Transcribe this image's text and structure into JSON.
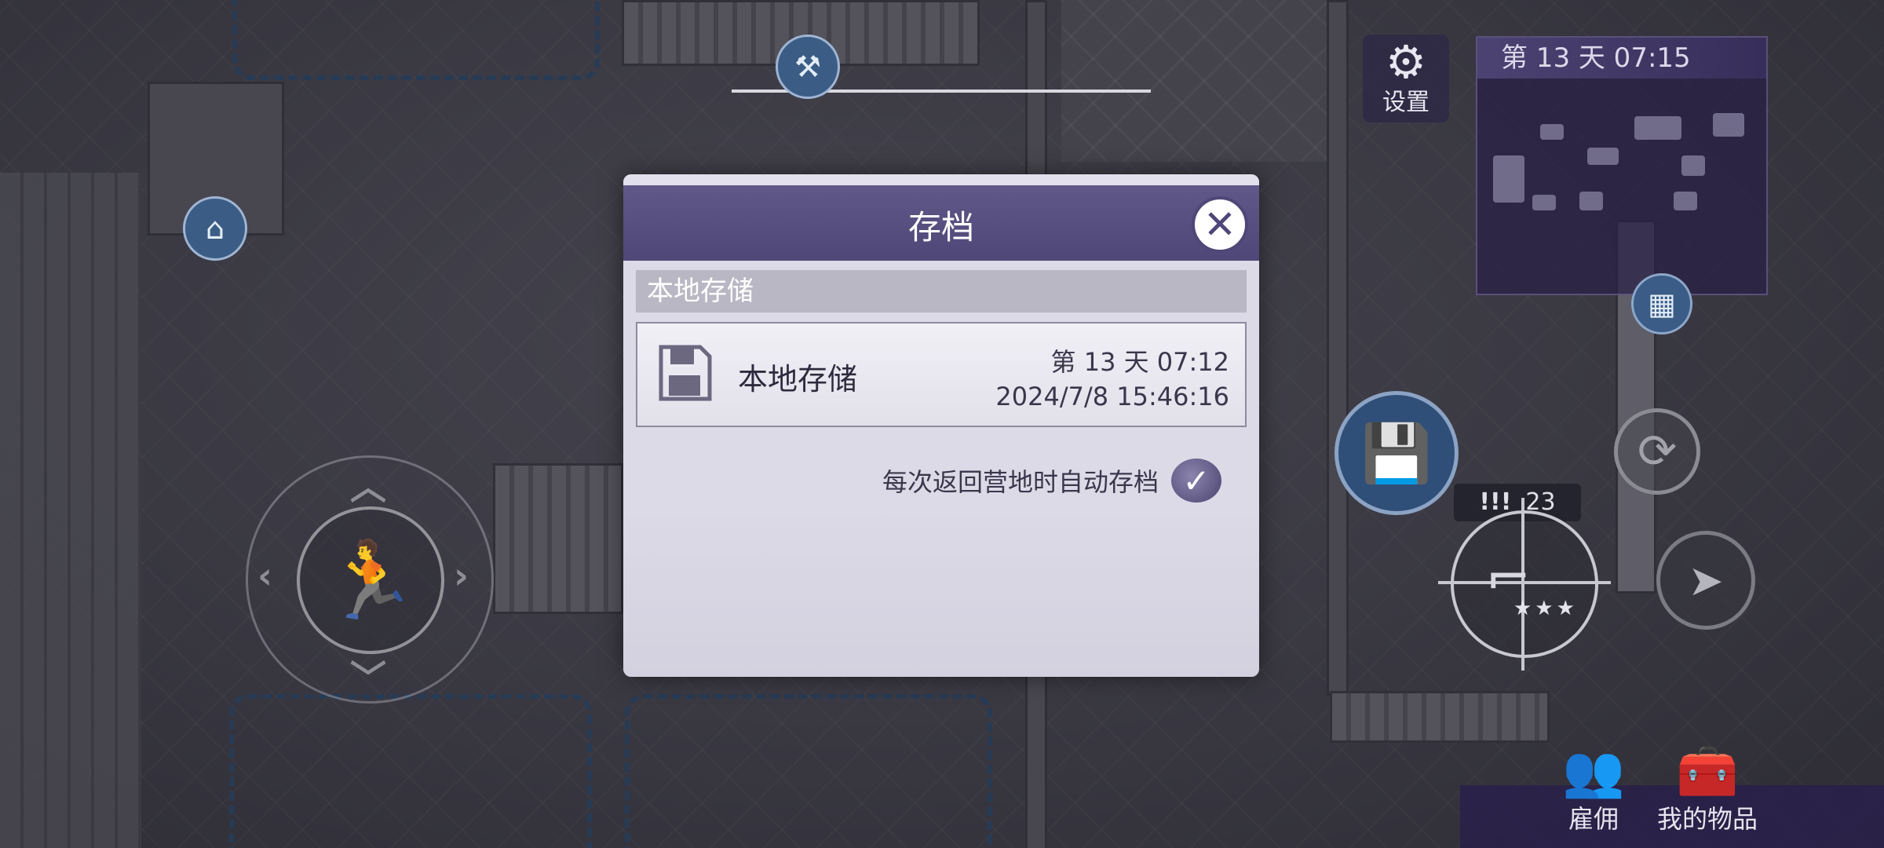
{
  "hud": {
    "settings_label": "设置",
    "day_time": "第 13 天  07:15",
    "ammo_warning": "!!!",
    "ammo_count": "23",
    "weapon_rating": "★★★",
    "bottom": {
      "hire_label": "雇佣",
      "items_label": "我的物品"
    },
    "icons": {
      "settings": "gear-icon",
      "run": "running-man-icon",
      "save": "save-upload-icon",
      "sync": "sync-icon",
      "dash": "dash-icon",
      "map": "map-icon",
      "dog": "dog-house-icon",
      "fork": "pitchfork-icon",
      "weapon": "shotgun-icon",
      "hire": "people-icon",
      "items": "chest-icon"
    }
  },
  "dialog": {
    "title": "存档",
    "close_icon": "close-icon",
    "section_label": "本地存储",
    "slot": {
      "name": "本地存储",
      "day_time": "第 13 天  07:12",
      "datetime": "2024/7/8 15:46:16",
      "icon": "floppy-disk-icon"
    },
    "auto_save_label": "每次返回营地时自动存档",
    "auto_save_checked": true
  },
  "colors": {
    "dialog_header": "#5f5888",
    "dialog_body": "#dcdae6",
    "hud_blue": "#2f4f78"
  }
}
